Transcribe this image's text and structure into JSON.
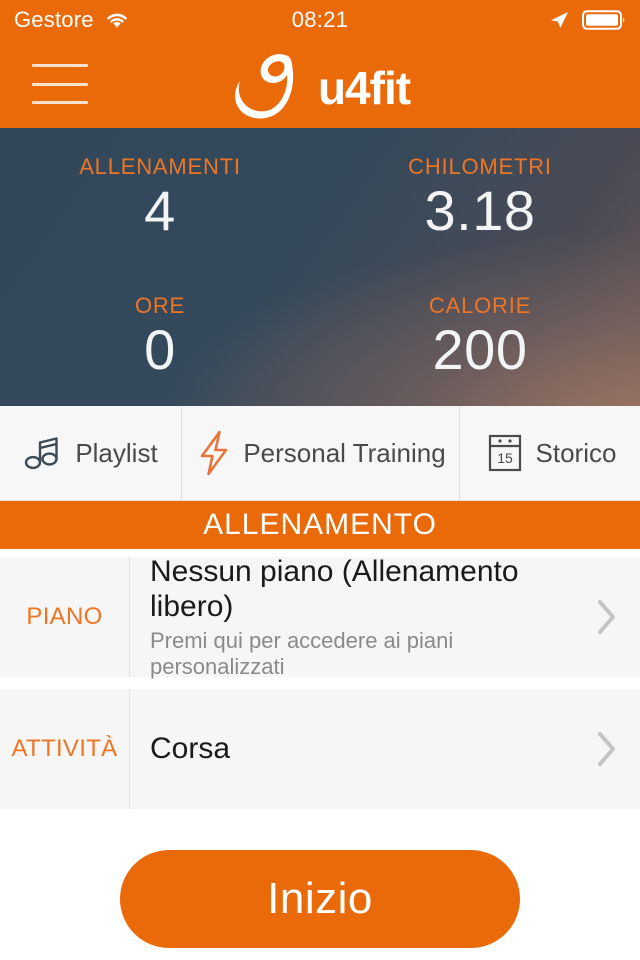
{
  "status_bar": {
    "carrier": "Gestore",
    "time": "08:21",
    "wifi_icon": "wifi-icon",
    "location_icon": "location-arrow-icon",
    "battery_icon": "battery-icon"
  },
  "navbar": {
    "menu_icon": "hamburger-menu-icon",
    "logo_mark": "u4fit-swoosh-logo-icon",
    "logo_text": "u4fit"
  },
  "stats": {
    "items": [
      {
        "label": "ALLENAMENTI",
        "value": "4"
      },
      {
        "label": "CHILOMETRI",
        "value": "3.18"
      },
      {
        "label": "ORE",
        "value": "0"
      },
      {
        "label": "CALORIE",
        "value": "200"
      }
    ]
  },
  "tabs": [
    {
      "label": "Playlist",
      "icon": "music-notes-icon"
    },
    {
      "label": "Personal Training",
      "icon": "lightning-bolt-icon"
    },
    {
      "label": "Storico",
      "icon": "calendar-icon",
      "calendar_day": "15"
    }
  ],
  "section": {
    "title": "ALLENAMENTO"
  },
  "form_rows": [
    {
      "key": "PIANO",
      "title": "Nessun piano (Allenamento libero)",
      "subtitle": "Premi qui per accedere ai piani personalizzati",
      "chevron_icon": "chevron-right-icon"
    },
    {
      "key": "ATTIVITÀ",
      "title": "Corsa",
      "subtitle": "",
      "chevron_icon": "chevron-right-icon"
    }
  ],
  "start_button": {
    "label": "Inizio"
  },
  "colors": {
    "brand_orange": "#EA6A0A",
    "accent_orange": "#EE7524",
    "panel_dark": "#344A5C",
    "row_background": "#F6F6F6",
    "text_dark": "#1A1A1A",
    "text_muted": "#8A8A8A"
  }
}
